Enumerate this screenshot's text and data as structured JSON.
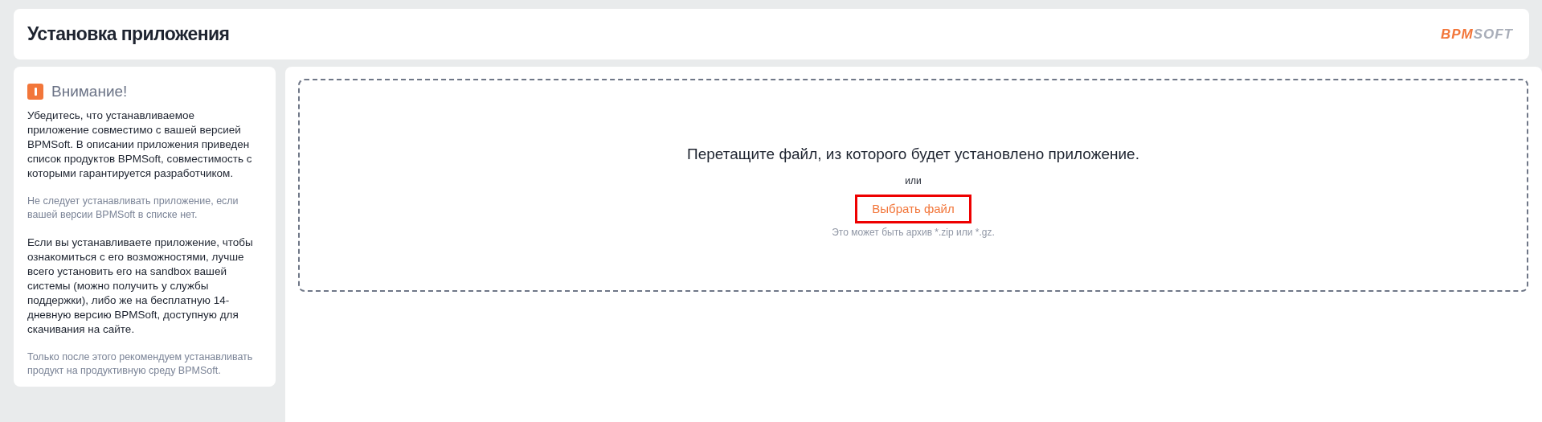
{
  "header": {
    "title": "Установка приложения",
    "logo": {
      "accent": "BPM",
      "rest": "SOFT"
    }
  },
  "notice": {
    "title": "Внимание!",
    "paragraphs": [
      {
        "kind": "main",
        "text": "Убедитесь, что устанавливаемое приложение совместимо с вашей версией BPMSoft. В описании приложения приведен список продуктов BPMSoft, совместимость с которыми гарантируется разработчиком."
      },
      {
        "kind": "muted",
        "text": "Не следует устанавливать приложение, если вашей версии BPMSoft в списке нет."
      },
      {
        "kind": "main",
        "text": "Если вы устанавливаете приложение, чтобы ознакомиться с его возможностями, лучше всего установить его на sandbox вашей системы (можно получить у службы поддержки), либо же на бесплатную 14-дневную версию BPMSoft, доступную для скачивания на сайте."
      },
      {
        "kind": "muted",
        "text": "Только после этого рекомендуем устанавливать продукт на продуктивную среду BPMSoft."
      }
    ]
  },
  "dropzone": {
    "prompt": "Перетащите файл, из которого будет установлено приложение.",
    "or": "или",
    "button": "Выбрать файл",
    "hint": "Это может быть архив *.zip или *.gz."
  }
}
